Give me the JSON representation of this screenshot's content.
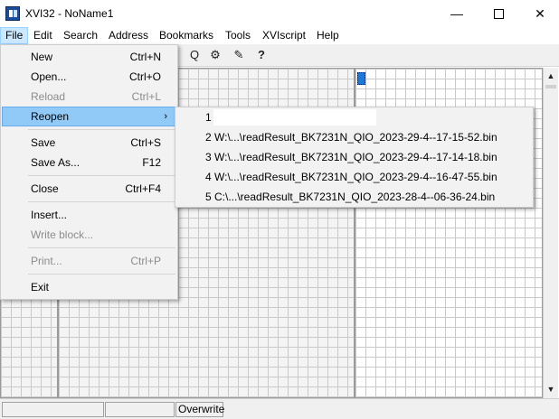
{
  "window": {
    "title": "XVI32 - NoName1",
    "minimize": "—",
    "close": "✕"
  },
  "menubar": [
    "File",
    "Edit",
    "Search",
    "Address",
    "Bookmarks",
    "Tools",
    "XVIscript",
    "Help"
  ],
  "toolbar": {
    "icons": [
      "search-replace-icon",
      "properties-icon",
      "script-icon",
      "help-pointer-icon"
    ],
    "glyphs": [
      "Q",
      "⚙",
      "✎",
      "?"
    ]
  },
  "file_menu": {
    "items": [
      {
        "label": "New",
        "shortcut": "Ctrl+N",
        "enabled": true
      },
      {
        "label": "Open...",
        "shortcut": "Ctrl+O",
        "enabled": true
      },
      {
        "label": "Reload",
        "shortcut": "Ctrl+L",
        "enabled": false
      },
      {
        "label": "Reopen",
        "shortcut": "",
        "enabled": true,
        "submenu_arrow": "›"
      },
      {
        "label": "Save",
        "shortcut": "Ctrl+S",
        "enabled": true
      },
      {
        "label": "Save As...",
        "shortcut": "F12",
        "enabled": true
      },
      {
        "label": "Close",
        "shortcut": "Ctrl+F4",
        "enabled": true
      },
      {
        "label": "Insert...",
        "shortcut": "",
        "enabled": true
      },
      {
        "label": "Write block...",
        "shortcut": "",
        "enabled": false
      },
      {
        "label": "Print...",
        "shortcut": "Ctrl+P",
        "enabled": false
      },
      {
        "label": "Exit",
        "shortcut": "",
        "enabled": true
      }
    ]
  },
  "reopen_menu": {
    "items": [
      "1",
      "2 W:\\...\\readResult_BK7231N_QIO_2023-29-4--17-15-52.bin",
      "3 W:\\...\\readResult_BK7231N_QIO_2023-29-4--17-14-18.bin",
      "4 W:\\...\\readResult_BK7231N_QIO_2023-29-4--16-47-55.bin",
      "5 C:\\...\\readResult_BK7231N_QIO_2023-28-4--06-36-24.bin"
    ]
  },
  "scrollbar": {
    "up": "▲",
    "down": "▼"
  },
  "statusbar": {
    "mode": "Overwrite"
  }
}
